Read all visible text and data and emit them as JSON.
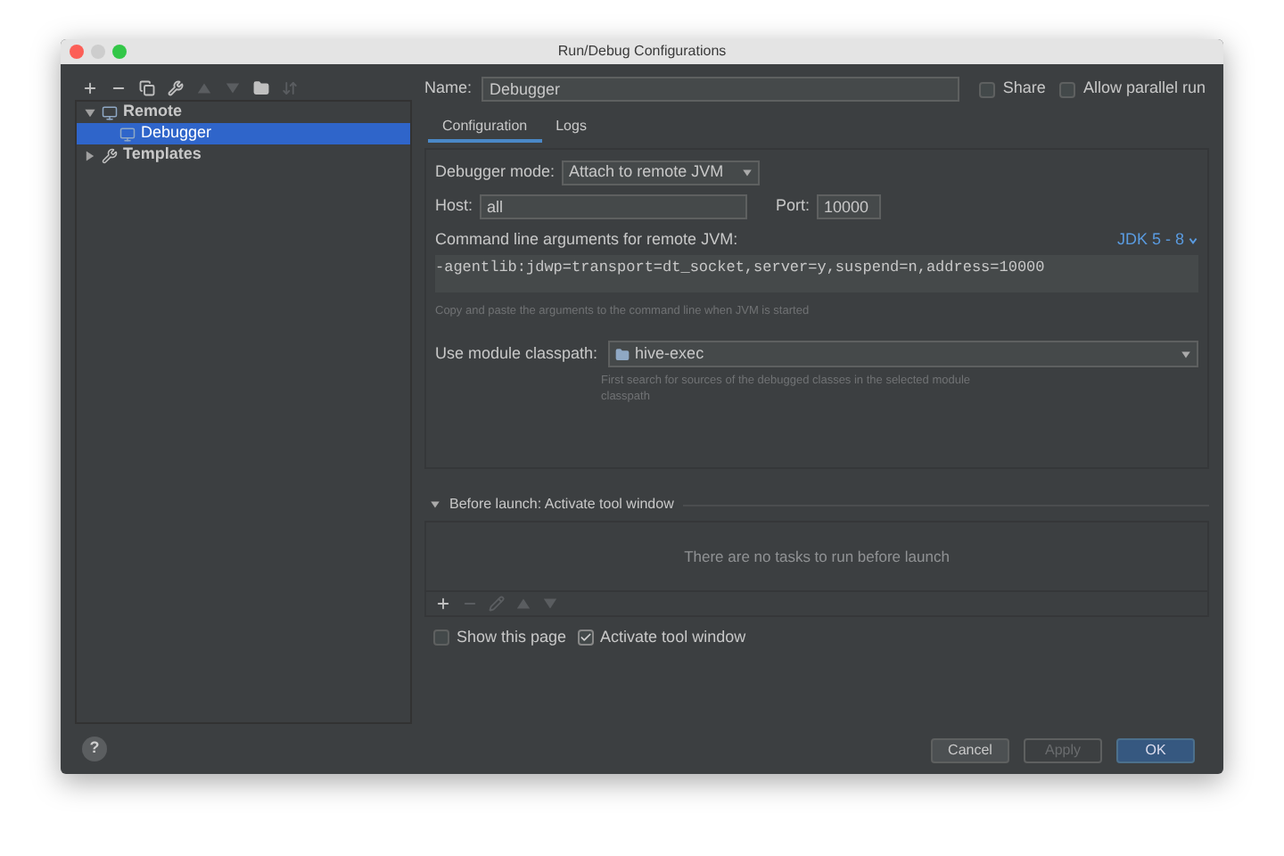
{
  "window": {
    "title": "Run/Debug Configurations"
  },
  "toolbar": [
    {
      "kind": "add",
      "disabled": false
    },
    {
      "kind": "remove",
      "disabled": false
    },
    {
      "kind": "copy",
      "disabled": false
    },
    {
      "kind": "wrench",
      "disabled": false
    },
    {
      "kind": "up",
      "disabled": true
    },
    {
      "kind": "down",
      "disabled": true
    },
    {
      "kind": "folder",
      "disabled": false
    },
    {
      "kind": "sort",
      "disabled": true
    }
  ],
  "tree": [
    {
      "label": "Remote",
      "kind": "remote",
      "expanded": true,
      "selected": false,
      "children": [
        {
          "label": "Debugger",
          "kind": "remote",
          "selected": true
        }
      ]
    },
    {
      "label": "Templates",
      "kind": "wrench",
      "expanded": false,
      "selected": false
    }
  ],
  "name_field": {
    "label": "Name:",
    "value": "Debugger"
  },
  "options": [
    {
      "label": "Share",
      "checked": false
    },
    {
      "label": "Allow parallel run",
      "checked": false
    }
  ],
  "tabs": [
    {
      "label": "Configuration",
      "selected": true
    },
    {
      "label": "Logs",
      "selected": false
    }
  ],
  "debugger_mode": {
    "label": "Debugger mode:",
    "value": "Attach to remote JVM"
  },
  "host": {
    "label": "Host:",
    "value": "all"
  },
  "port": {
    "label": "Port:",
    "value": "10000"
  },
  "command_args": {
    "label": "Command line arguments for remote JVM:",
    "jdk": "JDK 5 - 8",
    "value": "-agentlib:jdwp=transport=dt_socket,server=y,suspend=n,address=10000",
    "hint": "Copy and paste the arguments to the command line when JVM is started"
  },
  "module_classpath": {
    "label": "Use module classpath:",
    "value": "hive-exec",
    "hint": "First search for sources of the debugged classes in the selected module classpath"
  },
  "before_launch": {
    "title": "Before launch: Activate tool window",
    "expanded": true,
    "empty_text": "There are no tasks to run before launch",
    "toolbar": [
      {
        "kind": "add",
        "disabled": false
      },
      {
        "kind": "remove",
        "disabled": true
      },
      {
        "kind": "edit",
        "disabled": true
      },
      {
        "kind": "up",
        "disabled": true
      },
      {
        "kind": "down",
        "disabled": true
      }
    ]
  },
  "launch_options": [
    {
      "label": "Show this page",
      "checked": false
    },
    {
      "label": "Activate tool window",
      "checked": true
    }
  ],
  "help": "?",
  "buttons": [
    {
      "label": "Cancel",
      "kind": "secondary",
      "disabled": false
    },
    {
      "label": "Apply",
      "kind": "secondary",
      "disabled": true
    },
    {
      "label": "OK",
      "kind": "primary",
      "disabled": false
    }
  ]
}
